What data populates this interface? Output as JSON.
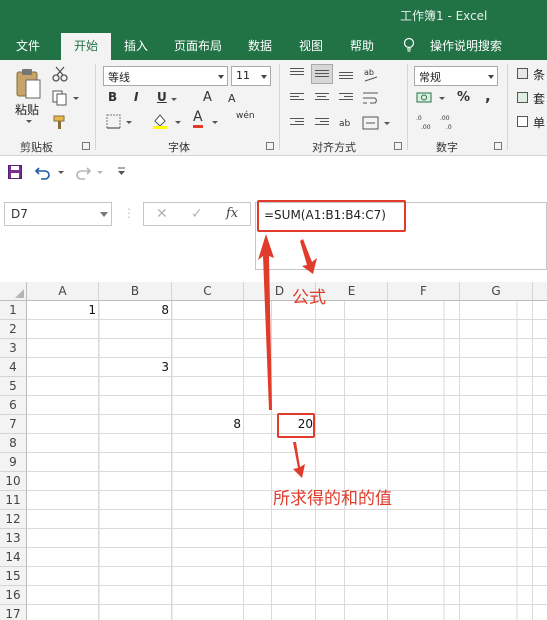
{
  "window": {
    "title": "工作簿1  -  Excel"
  },
  "menu": {
    "tabs": [
      "文件",
      "开始",
      "插入",
      "页面布局",
      "数据",
      "视图",
      "帮助"
    ],
    "active_tab": "开始",
    "tell_me": "操作说明搜索"
  },
  "ribbon": {
    "clipboard": {
      "paste_label": "粘贴",
      "group_label": "剪贴板"
    },
    "font": {
      "name": "等线",
      "size": "11",
      "bold": "B",
      "italic": "I",
      "underline": "U",
      "font_color_glyph": "A",
      "phonetic_glyph": "wén",
      "grow_glyph": "A",
      "shrink_glyph": "A",
      "group_label": "字体"
    },
    "alignment": {
      "group_label": "对齐方式"
    },
    "number": {
      "format": "常规",
      "percent": "%",
      "comma": ",",
      "group_label": "数字"
    },
    "styles": {
      "partial_labels": [
        "条",
        "套",
        "单"
      ]
    }
  },
  "formula_bar": {
    "name_box": "D7",
    "cancel_glyph": "✕",
    "enter_glyph": "✓",
    "fx_label": "fx",
    "formula": "=SUM(A1:B1:B4:C7)"
  },
  "sheet": {
    "columns": [
      "A",
      "B",
      "C",
      "D",
      "E",
      "F",
      "G"
    ],
    "rows": [
      "1",
      "2",
      "3",
      "4",
      "5",
      "6",
      "7",
      "8",
      "9",
      "10",
      "11",
      "12",
      "13",
      "14",
      "15",
      "16",
      "17"
    ],
    "cells": {
      "A1": "1",
      "B1": "8",
      "B4": "3",
      "C7": "8",
      "D7": "20"
    }
  },
  "annotations": {
    "formula_label": "公式",
    "result_label": "所求得的和的值",
    "color": "#e03b2b"
  },
  "colors": {
    "excel_green": "#217346",
    "annotation_red": "#e03b2b"
  }
}
